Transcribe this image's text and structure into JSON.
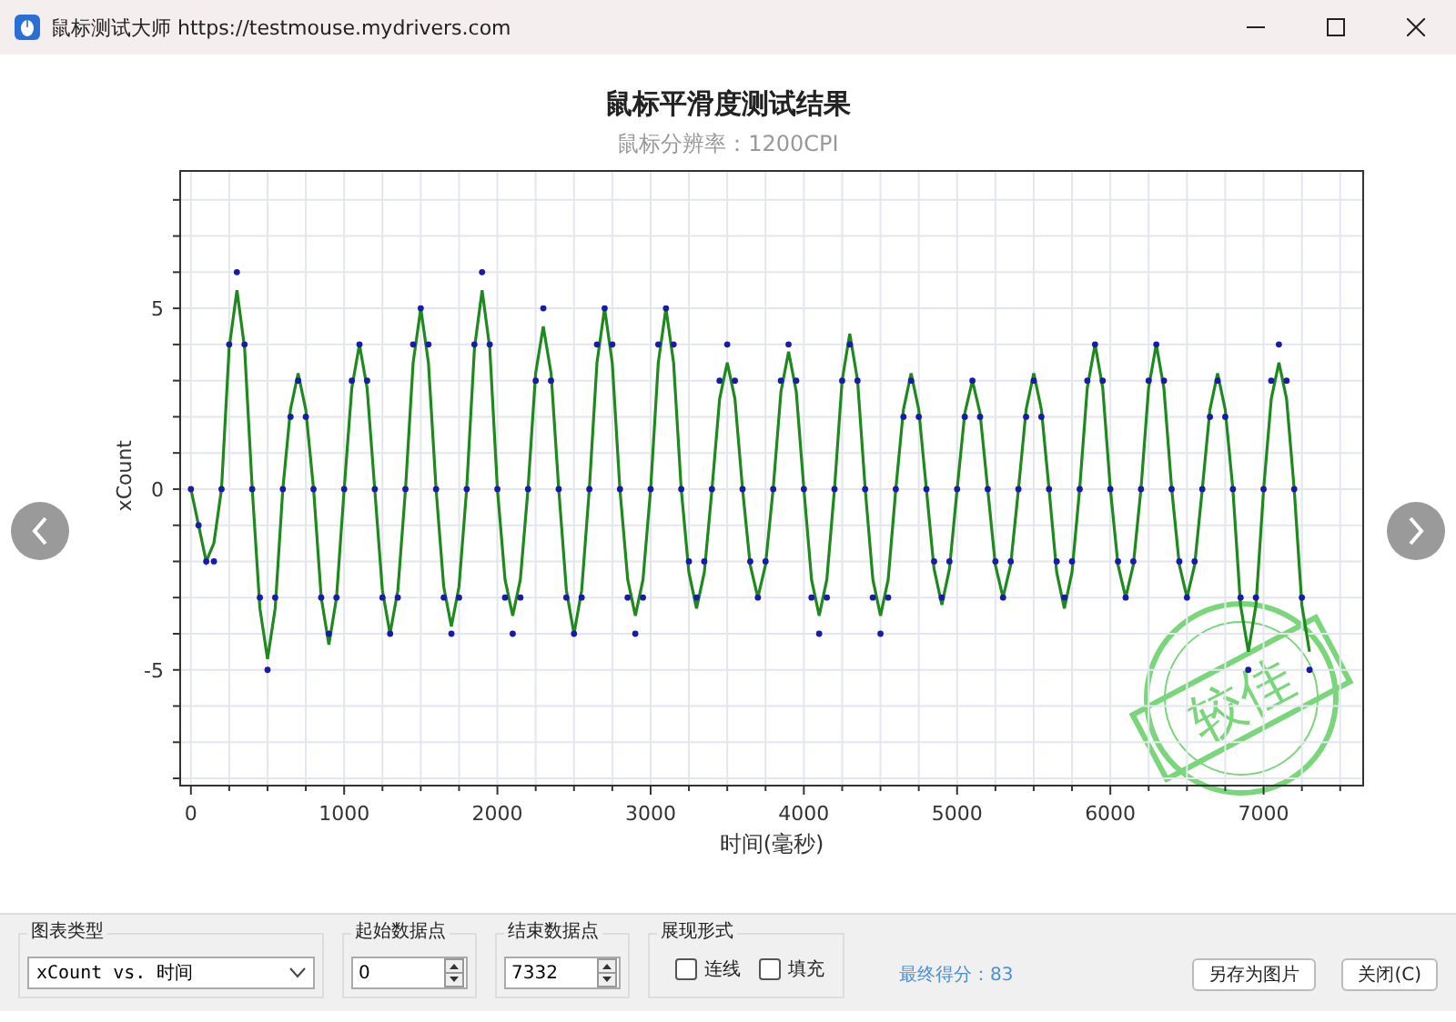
{
  "window": {
    "title": "鼠标测试大师 https://testmouse.mydrivers.com"
  },
  "chart": {
    "title": "鼠标平滑度测试结果",
    "subtitle": "鼠标分辨率：1200CPI",
    "chart_data": {
      "type": "line",
      "xlabel": "时间(毫秒)",
      "ylabel": "xCount",
      "xlim": [
        -70,
        7650
      ],
      "ylim": [
        -8.2,
        8.8
      ],
      "grid": true,
      "xticks": [
        0,
        1000,
        2000,
        3000,
        4000,
        5000,
        6000,
        7000
      ],
      "yticks": [
        -5,
        0,
        5
      ],
      "x": [
        0,
        50,
        100,
        150,
        200,
        250,
        300,
        350,
        400,
        450,
        500,
        550,
        600,
        650,
        700,
        750,
        800,
        850,
        900,
        950,
        1000,
        1050,
        1100,
        1150,
        1200,
        1250,
        1300,
        1350,
        1400,
        1450,
        1500,
        1550,
        1600,
        1650,
        1700,
        1750,
        1800,
        1850,
        1900,
        1950,
        2000,
        2050,
        2100,
        2150,
        2200,
        2250,
        2300,
        2350,
        2400,
        2450,
        2500,
        2550,
        2600,
        2650,
        2700,
        2750,
        2800,
        2850,
        2900,
        2950,
        3000,
        3050,
        3100,
        3150,
        3200,
        3250,
        3300,
        3350,
        3400,
        3450,
        3500,
        3550,
        3600,
        3650,
        3700,
        3750,
        3800,
        3850,
        3900,
        3950,
        4000,
        4050,
        4100,
        4150,
        4200,
        4250,
        4300,
        4350,
        4400,
        4450,
        4500,
        4550,
        4600,
        4650,
        4700,
        4750,
        4800,
        4850,
        4900,
        4950,
        5000,
        5050,
        5100,
        5150,
        5200,
        5250,
        5300,
        5350,
        5400,
        5450,
        5500,
        5550,
        5600,
        5650,
        5700,
        5750,
        5800,
        5850,
        5900,
        5950,
        6000,
        6050,
        6100,
        6150,
        6200,
        6250,
        6300,
        6350,
        6400,
        6450,
        6500,
        6550,
        6600,
        6650,
        6700,
        6750,
        6800,
        6850,
        6900,
        6950,
        7000,
        7050,
        7100,
        7150,
        7200,
        7250,
        7300
      ],
      "series": [
        {
          "color": "#1e8a1e",
          "values": [
            0,
            -1,
            -2,
            -1.5,
            0,
            3.9,
            5.5,
            3.9,
            0,
            -3.3,
            -4.7,
            -3.3,
            0,
            2.2,
            3.2,
            2.2,
            0,
            -3,
            -4.3,
            -3,
            0,
            2.8,
            4,
            2.8,
            0,
            -2.8,
            -4,
            -2.8,
            0,
            3.5,
            5,
            3.5,
            0,
            -2.7,
            -3.8,
            -2.7,
            0,
            3.9,
            5.5,
            3.9,
            0,
            -2.5,
            -3.5,
            -2.5,
            0,
            3.2,
            4.5,
            3.2,
            0,
            -2.8,
            -4,
            -2.8,
            0,
            3.5,
            5,
            3.5,
            0,
            -2.5,
            -3.5,
            -2.5,
            0,
            3.5,
            5,
            3.5,
            0,
            -2.3,
            -3.3,
            -2.3,
            0,
            2.5,
            3.5,
            2.5,
            0,
            -2.1,
            -3,
            -2.1,
            0,
            2.7,
            3.8,
            2.7,
            0,
            -2.5,
            -3.5,
            -2.5,
            0,
            3,
            4.3,
            3,
            0,
            -2.5,
            -3.5,
            -2.5,
            0,
            2.2,
            3.2,
            2.2,
            0,
            -2.2,
            -3.2,
            -2.2,
            0,
            2.1,
            3,
            2.1,
            0,
            -2.1,
            -3,
            -2.1,
            0,
            2.2,
            3.2,
            2.2,
            0,
            -2.3,
            -3.3,
            -2.3,
            0,
            2.8,
            4,
            2.8,
            0,
            -2.1,
            -3,
            -2.1,
            0,
            2.8,
            4,
            2.8,
            0,
            -2.1,
            -3,
            -2.1,
            0,
            2.2,
            3.2,
            2.2,
            0,
            -3.2,
            -4.5,
            -3.2,
            0,
            2.5,
            3.5,
            2.5,
            0,
            -3.2,
            -4.5
          ]
        },
        {
          "type": "scatter",
          "color": "#1a1aa8",
          "values": [
            0,
            -1,
            -2,
            -2,
            0,
            4,
            6,
            4,
            0,
            -3,
            -5,
            -3,
            0,
            2,
            3,
            2,
            0,
            -3,
            -4,
            -3,
            0,
            3,
            4,
            3,
            0,
            -3,
            -4,
            -3,
            0,
            4,
            5,
            4,
            0,
            -3,
            -4,
            -3,
            0,
            4,
            6,
            4,
            0,
            -3,
            -4,
            -3,
            0,
            3,
            5,
            3,
            0,
            -3,
            -4,
            -3,
            0,
            4,
            5,
            4,
            0,
            -3,
            -4,
            -3,
            0,
            4,
            5,
            4,
            0,
            -2,
            -3,
            -2,
            0,
            3,
            4,
            3,
            0,
            -2,
            -3,
            -2,
            0,
            3,
            4,
            3,
            0,
            -3,
            -4,
            -3,
            0,
            3,
            4,
            3,
            0,
            -3,
            -4,
            -3,
            0,
            2,
            3,
            2,
            0,
            -2,
            -3,
            -2,
            0,
            2,
            3,
            2,
            0,
            -2,
            -3,
            -2,
            0,
            2,
            3,
            2,
            0,
            -2,
            -3,
            -2,
            0,
            3,
            4,
            3,
            0,
            -2,
            -3,
            -2,
            0,
            3,
            4,
            3,
            0,
            -2,
            -3,
            -2,
            0,
            2,
            3,
            2,
            0,
            -3,
            -5,
            -3,
            0,
            3,
            4,
            3,
            0,
            -3,
            -5
          ]
        }
      ]
    }
  },
  "stamp": {
    "text": "较佳"
  },
  "controls": {
    "chart_type": {
      "label": "图表类型",
      "value": "xCount vs. 时间"
    },
    "start_point": {
      "label": "起始数据点",
      "value": "0"
    },
    "end_point": {
      "label": "结束数据点",
      "value": "7332"
    },
    "display": {
      "label": "展现形式",
      "options": [
        {
          "label": "连线",
          "checked": false
        },
        {
          "label": "填充",
          "checked": false
        }
      ]
    },
    "score": "最终得分：83",
    "buttons": [
      "另存为图片",
      "关闭(C)"
    ]
  }
}
